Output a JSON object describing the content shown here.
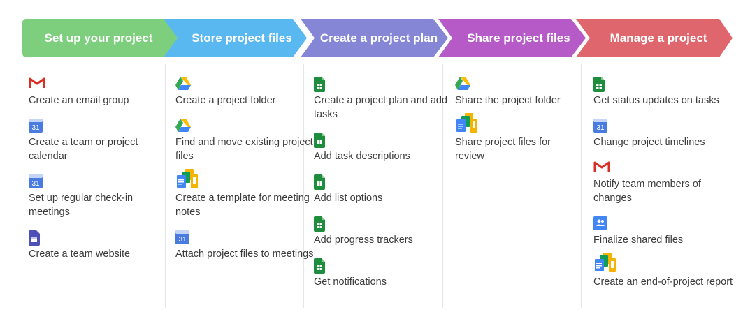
{
  "steps": [
    {
      "label": "Set up your project",
      "color": "#7dcf7e"
    },
    {
      "label": "Store project files",
      "color": "#5ab8f1"
    },
    {
      "label": "Create a project plan",
      "color": "#8587d6"
    },
    {
      "label": "Share project files",
      "color": "#b65ac8"
    },
    {
      "label": "Manage a project",
      "color": "#e0666d"
    }
  ],
  "columns": [
    {
      "items": [
        {
          "icon": "gmail-icon",
          "text": "Create an email group"
        },
        {
          "icon": "calendar-icon",
          "text": "Create a team or project calendar"
        },
        {
          "icon": "calendar-icon",
          "text": "Set up regular check-in meetings"
        },
        {
          "icon": "sites-icon",
          "text": "Create a team website"
        }
      ]
    },
    {
      "items": [
        {
          "icon": "drive-icon",
          "text": "Create a project folder"
        },
        {
          "icon": "drive-icon",
          "text": "Find and move existing project files"
        },
        {
          "icon": "docs-editors-icon",
          "text": "Create a template for meeting notes"
        },
        {
          "icon": "calendar-icon",
          "text": "Attach project files to meetings"
        }
      ]
    },
    {
      "items": [
        {
          "icon": "sheets-icon",
          "text": "Create a project plan and add tasks"
        },
        {
          "icon": "sheets-icon",
          "text": "Add task descriptions"
        },
        {
          "icon": "sheets-icon",
          "text": "Add list options"
        },
        {
          "icon": "sheets-icon",
          "text": "Add progress trackers"
        },
        {
          "icon": "sheets-icon",
          "text": "Get notifications"
        }
      ]
    },
    {
      "items": [
        {
          "icon": "drive-icon",
          "text": "Share the project folder"
        },
        {
          "icon": "docs-editors-icon",
          "text": "Share project files for review"
        }
      ]
    },
    {
      "items": [
        {
          "icon": "sheets-icon",
          "text": "Get status updates on tasks"
        },
        {
          "icon": "calendar-icon",
          "text": "Change project timelines"
        },
        {
          "icon": "gmail-icon",
          "text": "Notify team members of changes"
        },
        {
          "icon": "groups-icon",
          "text": "Finalize shared files"
        },
        {
          "icon": "docs-editors-icon",
          "text": "Create an end-of-project report"
        }
      ]
    }
  ],
  "calendar_day": "31"
}
